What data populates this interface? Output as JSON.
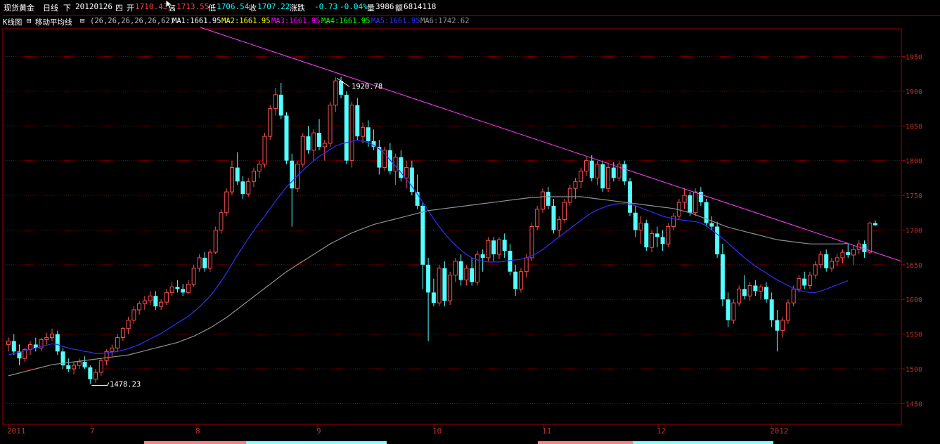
{
  "header": {
    "symbol": "现货黄金",
    "period": "日线",
    "direction": "下",
    "date": "20120126",
    "weekday": "四",
    "open_label": "开",
    "open": "1710.43",
    "high_label": "高",
    "high": "1713.55",
    "low_label": "低",
    "low": "1706.54",
    "close_label": "收",
    "close": "1707.22",
    "change_label": "涨跌",
    "change": "-0.73",
    "change_pct": "-0.04%",
    "volume_label": "量",
    "volume": "3986",
    "amount_label": "额",
    "amount": "6814118"
  },
  "indicator": {
    "chart_label": "K线图",
    "ma_label": "移动平均线",
    "params": "(26,26,26,26,26,62)",
    "ma1": "MA1:1661.95",
    "ma2": "MA2:1661.95",
    "ma3": "MA3:1661.95",
    "ma4": "MA4:1661.95",
    "ma5": "MA5:1661.95",
    "ma6": "MA6:1742.62",
    "colors": {
      "ma1": "#ffffff",
      "ma2": "#ffff00",
      "ma3": "#ff00ff",
      "ma4": "#00ff00",
      "ma5": "#3030ff",
      "ma6": "#909090"
    }
  },
  "chart_data": {
    "type": "candlestick",
    "ylim": [
      1420,
      1990
    ],
    "yticks": [
      1450,
      1500,
      1550,
      1600,
      1650,
      1700,
      1750,
      1800,
      1850,
      1900,
      1950
    ],
    "xlabels": [
      "2011",
      "7",
      "8",
      "9",
      "10",
      "11",
      "12",
      "2012"
    ],
    "annotations": [
      {
        "text": "1920.78",
        "value": 1920.78
      },
      {
        "text": "1478.23",
        "value": 1478.23
      }
    ],
    "trendline": {
      "from": 1992,
      "to": 1655,
      "color": "#ff40ff"
    },
    "ohlc": [
      [
        1535,
        1545,
        1525,
        1540
      ],
      [
        1540,
        1550,
        1520,
        1525
      ],
      [
        1525,
        1535,
        1505,
        1515
      ],
      [
        1515,
        1530,
        1510,
        1528
      ],
      [
        1528,
        1540,
        1520,
        1535
      ],
      [
        1535,
        1545,
        1525,
        1530
      ],
      [
        1530,
        1545,
        1525,
        1542
      ],
      [
        1542,
        1552,
        1535,
        1545
      ],
      [
        1545,
        1558,
        1540,
        1550
      ],
      [
        1550,
        1555,
        1520,
        1525
      ],
      [
        1525,
        1530,
        1500,
        1505
      ],
      [
        1505,
        1515,
        1495,
        1500
      ],
      [
        1500,
        1510,
        1492,
        1505
      ],
      [
        1505,
        1515,
        1500,
        1510
      ],
      [
        1510,
        1518,
        1500,
        1502
      ],
      [
        1502,
        1505,
        1478,
        1485
      ],
      [
        1485,
        1500,
        1480,
        1495
      ],
      [
        1495,
        1515,
        1490,
        1512
      ],
      [
        1512,
        1528,
        1505,
        1525
      ],
      [
        1525,
        1535,
        1518,
        1530
      ],
      [
        1530,
        1550,
        1525,
        1545
      ],
      [
        1545,
        1560,
        1540,
        1558
      ],
      [
        1558,
        1575,
        1550,
        1570
      ],
      [
        1570,
        1590,
        1565,
        1585
      ],
      [
        1585,
        1598,
        1578,
        1594
      ],
      [
        1594,
        1605,
        1585,
        1598
      ],
      [
        1598,
        1612,
        1592,
        1605
      ],
      [
        1605,
        1612,
        1585,
        1590
      ],
      [
        1590,
        1600,
        1585,
        1596
      ],
      [
        1596,
        1615,
        1592,
        1610
      ],
      [
        1610,
        1625,
        1605,
        1618
      ],
      [
        1618,
        1628,
        1610,
        1615
      ],
      [
        1615,
        1622,
        1605,
        1610
      ],
      [
        1610,
        1628,
        1608,
        1622
      ],
      [
        1622,
        1650,
        1618,
        1645
      ],
      [
        1645,
        1665,
        1640,
        1660
      ],
      [
        1660,
        1668,
        1640,
        1645
      ],
      [
        1645,
        1672,
        1640,
        1668
      ],
      [
        1668,
        1705,
        1665,
        1700
      ],
      [
        1700,
        1730,
        1695,
        1725
      ],
      [
        1725,
        1760,
        1720,
        1755
      ],
      [
        1755,
        1800,
        1750,
        1790
      ],
      [
        1790,
        1812,
        1765,
        1770
      ],
      [
        1770,
        1778,
        1745,
        1752
      ],
      [
        1752,
        1775,
        1748,
        1770
      ],
      [
        1770,
        1790,
        1762,
        1785
      ],
      [
        1785,
        1800,
        1775,
        1795
      ],
      [
        1795,
        1840,
        1790,
        1835
      ],
      [
        1835,
        1880,
        1830,
        1875
      ],
      [
        1875,
        1905,
        1865,
        1895
      ],
      [
        1895,
        1912,
        1860,
        1865
      ],
      [
        1865,
        1870,
        1795,
        1800
      ],
      [
        1800,
        1810,
        1705,
        1760
      ],
      [
        1760,
        1800,
        1755,
        1795
      ],
      [
        1795,
        1840,
        1790,
        1835
      ],
      [
        1835,
        1850,
        1810,
        1815
      ],
      [
        1815,
        1845,
        1800,
        1840
      ],
      [
        1840,
        1860,
        1815,
        1820
      ],
      [
        1820,
        1830,
        1800,
        1825
      ],
      [
        1825,
        1885,
        1820,
        1880
      ],
      [
        1880,
        1920,
        1870,
        1915
      ],
      [
        1915,
        1921,
        1890,
        1895
      ],
      [
        1895,
        1900,
        1795,
        1800
      ],
      [
        1800,
        1885,
        1790,
        1880
      ],
      [
        1880,
        1890,
        1830,
        1835
      ],
      [
        1835,
        1855,
        1825,
        1848
      ],
      [
        1848,
        1858,
        1820,
        1828
      ],
      [
        1828,
        1845,
        1815,
        1820
      ],
      [
        1820,
        1830,
        1780,
        1790
      ],
      [
        1790,
        1820,
        1785,
        1815
      ],
      [
        1815,
        1825,
        1780,
        1785
      ],
      [
        1785,
        1810,
        1765,
        1805
      ],
      [
        1805,
        1815,
        1770,
        1775
      ],
      [
        1775,
        1800,
        1760,
        1790
      ],
      [
        1790,
        1800,
        1750,
        1755
      ],
      [
        1755,
        1780,
        1730,
        1735
      ],
      [
        1735,
        1740,
        1615,
        1650
      ],
      [
        1650,
        1660,
        1540,
        1610
      ],
      [
        1610,
        1630,
        1590,
        1595
      ],
      [
        1595,
        1650,
        1590,
        1645
      ],
      [
        1645,
        1655,
        1590,
        1598
      ],
      [
        1598,
        1640,
        1592,
        1635
      ],
      [
        1635,
        1660,
        1625,
        1655
      ],
      [
        1655,
        1665,
        1620,
        1628
      ],
      [
        1628,
        1650,
        1620,
        1645
      ],
      [
        1645,
        1660,
        1620,
        1625
      ],
      [
        1625,
        1670,
        1620,
        1665
      ],
      [
        1665,
        1672,
        1640,
        1660
      ],
      [
        1660,
        1690,
        1655,
        1685
      ],
      [
        1685,
        1690,
        1655,
        1665
      ],
      [
        1665,
        1690,
        1658,
        1686
      ],
      [
        1686,
        1695,
        1660,
        1670
      ],
      [
        1670,
        1680,
        1635,
        1640
      ],
      [
        1640,
        1650,
        1605,
        1615
      ],
      [
        1615,
        1645,
        1610,
        1640
      ],
      [
        1640,
        1665,
        1632,
        1660
      ],
      [
        1660,
        1710,
        1655,
        1705
      ],
      [
        1705,
        1735,
        1700,
        1730
      ],
      [
        1730,
        1760,
        1725,
        1755
      ],
      [
        1755,
        1762,
        1730,
        1735
      ],
      [
        1735,
        1745,
        1695,
        1700
      ],
      [
        1700,
        1720,
        1690,
        1715
      ],
      [
        1715,
        1745,
        1710,
        1740
      ],
      [
        1740,
        1765,
        1735,
        1760
      ],
      [
        1760,
        1775,
        1745,
        1770
      ],
      [
        1770,
        1790,
        1760,
        1785
      ],
      [
        1785,
        1805,
        1778,
        1800
      ],
      [
        1800,
        1808,
        1770,
        1775
      ],
      [
        1775,
        1800,
        1765,
        1795
      ],
      [
        1795,
        1800,
        1755,
        1760
      ],
      [
        1760,
        1795,
        1755,
        1790
      ],
      [
        1790,
        1798,
        1770,
        1775
      ],
      [
        1775,
        1800,
        1770,
        1795
      ],
      [
        1795,
        1800,
        1765,
        1770
      ],
      [
        1770,
        1775,
        1720,
        1725
      ],
      [
        1725,
        1735,
        1690,
        1700
      ],
      [
        1700,
        1720,
        1680,
        1710
      ],
      [
        1710,
        1715,
        1670,
        1675
      ],
      [
        1675,
        1700,
        1668,
        1695
      ],
      [
        1695,
        1705,
        1675,
        1690
      ],
      [
        1690,
        1700,
        1670,
        1680
      ],
      [
        1680,
        1710,
        1675,
        1705
      ],
      [
        1705,
        1725,
        1700,
        1720
      ],
      [
        1720,
        1745,
        1715,
        1740
      ],
      [
        1740,
        1760,
        1730,
        1750
      ],
      [
        1750,
        1755,
        1720,
        1725
      ],
      [
        1725,
        1760,
        1720,
        1755
      ],
      [
        1755,
        1762,
        1735,
        1740
      ],
      [
        1740,
        1745,
        1705,
        1710
      ],
      [
        1710,
        1720,
        1700,
        1705
      ],
      [
        1705,
        1712,
        1660,
        1665
      ],
      [
        1665,
        1680,
        1590,
        1600
      ],
      [
        1600,
        1610,
        1560,
        1570
      ],
      [
        1570,
        1600,
        1565,
        1595
      ],
      [
        1595,
        1620,
        1590,
        1615
      ],
      [
        1615,
        1635,
        1600,
        1605
      ],
      [
        1605,
        1625,
        1598,
        1620
      ],
      [
        1620,
        1628,
        1605,
        1612
      ],
      [
        1612,
        1622,
        1600,
        1618
      ],
      [
        1618,
        1625,
        1595,
        1600
      ],
      [
        1600,
        1610,
        1560,
        1570
      ],
      [
        1570,
        1585,
        1525,
        1555
      ],
      [
        1555,
        1575,
        1545,
        1570
      ],
      [
        1570,
        1600,
        1565,
        1595
      ],
      [
        1595,
        1620,
        1590,
        1615
      ],
      [
        1615,
        1635,
        1610,
        1630
      ],
      [
        1630,
        1640,
        1615,
        1620
      ],
      [
        1620,
        1640,
        1615,
        1635
      ],
      [
        1635,
        1655,
        1630,
        1650
      ],
      [
        1650,
        1670,
        1645,
        1665
      ],
      [
        1665,
        1672,
        1640,
        1645
      ],
      [
        1645,
        1660,
        1640,
        1655
      ],
      [
        1655,
        1665,
        1648,
        1660
      ],
      [
        1660,
        1672,
        1652,
        1668
      ],
      [
        1668,
        1680,
        1660,
        1664
      ],
      [
        1664,
        1678,
        1650,
        1672
      ],
      [
        1672,
        1685,
        1665,
        1680
      ],
      [
        1680,
        1685,
        1660,
        1668
      ],
      [
        1668,
        1712,
        1665,
        1710
      ],
      [
        1710,
        1714,
        1706,
        1707
      ]
    ],
    "ma_series": [
      {
        "name": "MA5",
        "color": "#3030ff",
        "values": [
          1520,
          1522,
          1524,
          1526,
          1528,
          1530,
          1532,
          1534,
          1536,
          1535,
          1532,
          1530,
          1528,
          1527,
          1525,
          1524,
          1522,
          1522,
          1523,
          1524,
          1525,
          1527,
          1529,
          1532,
          1535,
          1539,
          1543,
          1547,
          1551,
          1556,
          1561,
          1566,
          1571,
          1576,
          1582,
          1589,
          1597,
          1605,
          1615,
          1626,
          1638,
          1651,
          1664,
          1676,
          1688,
          1699,
          1710,
          1720,
          1731,
          1742,
          1752,
          1762,
          1770,
          1778,
          1786,
          1793,
          1800,
          1806,
          1811,
          1816,
          1821,
          1824,
          1826,
          1828,
          1829,
          1828,
          1826,
          1822,
          1817,
          1810,
          1801,
          1792,
          1783,
          1773,
          1763,
          1752,
          1740,
          1728,
          1716,
          1705,
          1695,
          1686,
          1678,
          1671,
          1665,
          1660,
          1657,
          1655,
          1654,
          1654,
          1654,
          1655,
          1656,
          1657,
          1658,
          1660,
          1663,
          1667,
          1672,
          1678,
          1684,
          1690,
          1696,
          1702,
          1708,
          1714,
          1720,
          1725,
          1729,
          1732,
          1735,
          1737,
          1738,
          1738,
          1737,
          1735,
          1732,
          1729,
          1726,
          1723,
          1720,
          1718,
          1716,
          1715,
          1714,
          1713,
          1712,
          1710,
          1706,
          1700,
          1694,
          1688,
          1681,
          1674,
          1667,
          1660,
          1654,
          1648,
          1643,
          1638,
          1633,
          1628,
          1624,
          1620,
          1616,
          1613,
          1611,
          1610,
          1610,
          1612,
          1615,
          1618,
          1621,
          1624,
          1627
        ]
      },
      {
        "name": "MA6",
        "color": "#909090",
        "values": [
          1490,
          1492,
          1494,
          1496,
          1498,
          1500,
          1502,
          1504,
          1506,
          1507,
          1508,
          1509,
          1510,
          1511,
          1512,
          1513,
          1514,
          1515,
          1516,
          1517,
          1518,
          1519,
          1520,
          1522,
          1524,
          1526,
          1528,
          1530,
          1532,
          1534,
          1536,
          1538,
          1541,
          1544,
          1547,
          1551,
          1555,
          1559,
          1564,
          1569,
          1574,
          1580,
          1586,
          1592,
          1598,
          1604,
          1610,
          1616,
          1622,
          1628,
          1634,
          1640,
          1645,
          1650,
          1655,
          1660,
          1665,
          1670,
          1675,
          1680,
          1684,
          1688,
          1692,
          1696,
          1699,
          1702,
          1705,
          1708,
          1710,
          1712,
          1714,
          1716,
          1718,
          1720,
          1722,
          1724,
          1726,
          1728,
          1729,
          1730,
          1731,
          1732,
          1733,
          1734,
          1735,
          1736,
          1737,
          1738,
          1739,
          1740,
          1741,
          1742,
          1743,
          1744,
          1745,
          1746,
          1747,
          1747,
          1748,
          1748,
          1748,
          1748,
          1748,
          1748,
          1748,
          1748,
          1747,
          1746,
          1745,
          1744,
          1743,
          1742,
          1741,
          1740,
          1739,
          1738,
          1737,
          1736,
          1735,
          1734,
          1733,
          1732,
          1731,
          1729,
          1727,
          1725,
          1722,
          1719,
          1716,
          1713,
          1710,
          1707,
          1704,
          1702,
          1700,
          1698,
          1696,
          1694,
          1692,
          1690,
          1688,
          1686,
          1685,
          1684,
          1683,
          1682,
          1681,
          1680,
          1680,
          1680,
          1680,
          1680,
          1680,
          1680,
          1681
        ]
      }
    ]
  }
}
